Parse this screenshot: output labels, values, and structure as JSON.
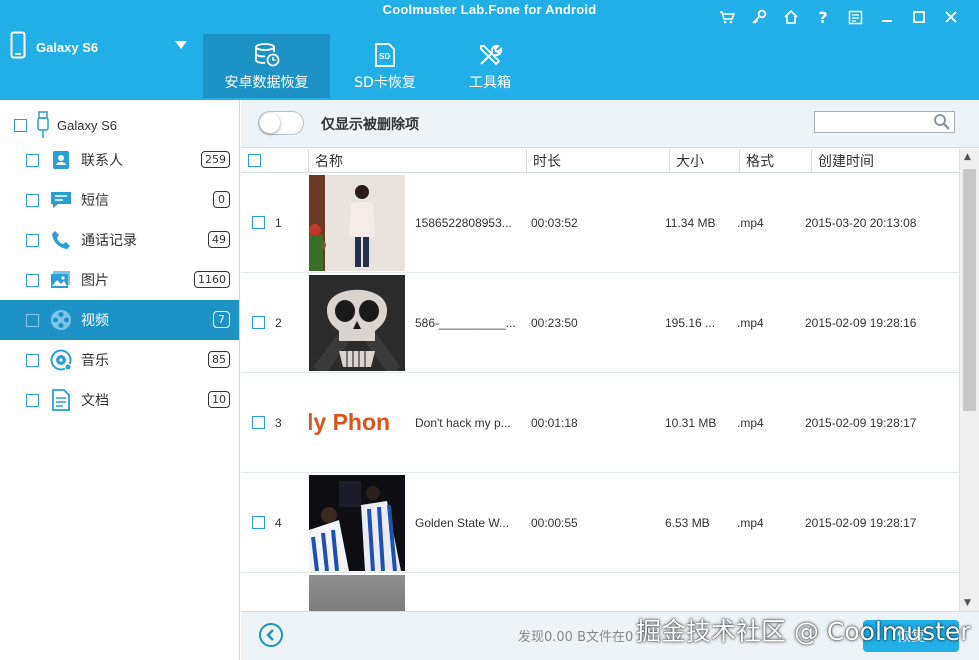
{
  "app": {
    "title": "Coolmuster Lab.Fone for Android"
  },
  "device": {
    "name": "Galaxy S6"
  },
  "tabs": [
    {
      "label": "安卓数据恢复",
      "icon": "database-clock-icon",
      "active": true
    },
    {
      "label": "SD卡恢复",
      "icon": "sd-card-icon",
      "active": false
    },
    {
      "label": "工具箱",
      "icon": "tools-icon",
      "active": false
    }
  ],
  "window_icons": [
    "cart-icon",
    "key-icon",
    "home-icon",
    "help-icon",
    "feedback-icon",
    "minimize-icon",
    "maximize-icon",
    "close-icon"
  ],
  "sidebar": {
    "root": "Galaxy S6",
    "items": [
      {
        "label": "联系人",
        "count": "259",
        "icon": "contacts-icon",
        "active": false
      },
      {
        "label": "短信",
        "count": "0",
        "icon": "sms-icon",
        "active": false
      },
      {
        "label": "通话记录",
        "count": "49",
        "icon": "phone-icon",
        "active": false
      },
      {
        "label": "图片",
        "count": "1160",
        "icon": "photos-icon",
        "active": false
      },
      {
        "label": "视频",
        "count": "7",
        "icon": "video-icon",
        "active": true
      },
      {
        "label": "音乐",
        "count": "85",
        "icon": "music-icon",
        "active": false
      },
      {
        "label": "文档",
        "count": "10",
        "icon": "document-icon",
        "active": false
      }
    ]
  },
  "filter": {
    "label": "仅显示被删除项",
    "toggle_on": false
  },
  "table": {
    "headers": {
      "name": "名称",
      "duration": "时长",
      "size": "大小",
      "format": "格式",
      "created": "创建时间"
    },
    "rows": [
      {
        "num": "1",
        "name": "1586522808953...",
        "duration": "00:03:52",
        "size": "11.34 MB",
        "format": ".mp4",
        "created": "2015-03-20 20:13:08",
        "thumb": "woman-standing"
      },
      {
        "num": "2",
        "name": "586-__________...",
        "duration": "00:23:50",
        "size": "195.16 ...",
        "format": ".mp4",
        "created": "2015-02-09 19:28:16",
        "thumb": "skull"
      },
      {
        "num": "3",
        "name": "Don't hack my p...",
        "duration": "00:01:18",
        "size": "10.31 MB",
        "format": ".mp4",
        "created": "2015-02-09 19:28:17",
        "thumb": "text-phone",
        "thumb_text": "ly Phon"
      },
      {
        "num": "4",
        "name": "Golden State W...",
        "duration": "00:00:55",
        "size": "6.53 MB",
        "format": ".mp4",
        "created": "2015-02-09 19:28:17",
        "thumb": "basketball"
      }
    ]
  },
  "footer": {
    "found_text": "发现0.00 B文件在0",
    "recover_label": "恢复"
  },
  "watermark": "掘金技术社区 @ Coolmuster",
  "colors": {
    "brand": "#22aee6",
    "active": "#1c93c4",
    "toolbar_bg": "#edf3f7"
  }
}
